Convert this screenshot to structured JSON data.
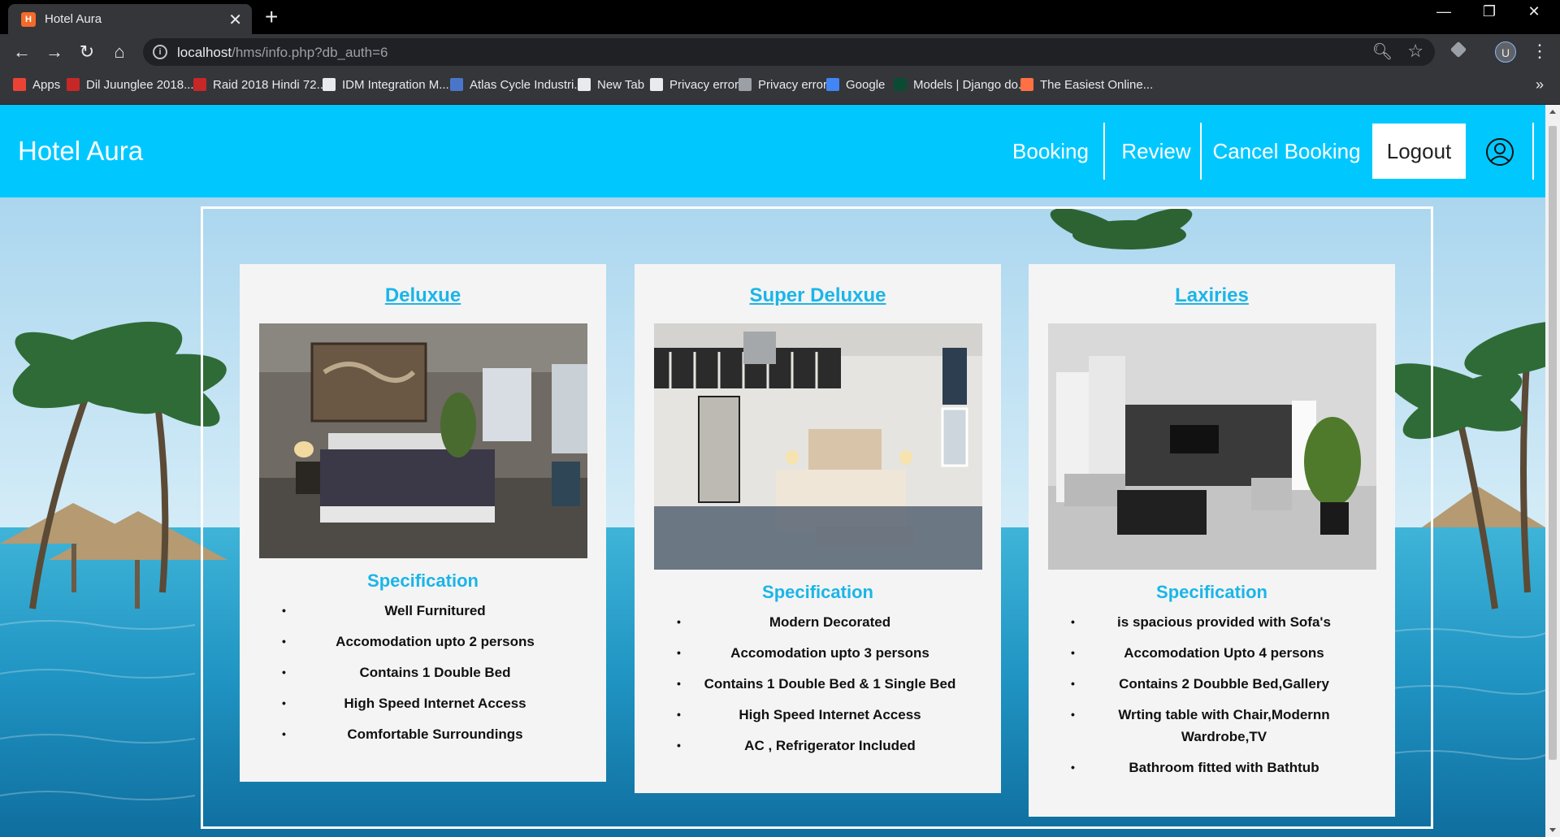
{
  "browser": {
    "tab_title": "Hotel Aura",
    "tab_favicon": "H",
    "url_host": "localhost",
    "url_path": "/hms/info.php?db_auth=6",
    "profile_initial": "U",
    "bookmarks": [
      {
        "label": "Apps",
        "color": "#ea4335"
      },
      {
        "label": "Dil Juunglee 2018...",
        "color": "#c62828"
      },
      {
        "label": "Raid 2018 Hindi 72...",
        "color": "#c62828"
      },
      {
        "label": "IDM Integration M...",
        "color": "#e8eaed"
      },
      {
        "label": "Atlas Cycle Industri...",
        "color": "#4a76c9"
      },
      {
        "label": "New Tab",
        "color": "#e8eaed"
      },
      {
        "label": "Privacy error",
        "color": "#e8eaed"
      },
      {
        "label": "Privacy error",
        "color": "#9aa0a6"
      },
      {
        "label": "Google",
        "color": "#4285f4"
      },
      {
        "label": "Models | Django do...",
        "color": "#0c4b33"
      },
      {
        "label": "The Easiest Online...",
        "color": "#ff7043"
      }
    ]
  },
  "header": {
    "brand": "Hotel Aura",
    "nav": [
      "Booking",
      "Review",
      "Cancel Booking"
    ],
    "logout": "Logout",
    "color": "#00c8ff"
  },
  "cards": [
    {
      "title": "Deluxue",
      "spec_heading": "Specification",
      "items": [
        "Well Furnitured",
        "Accomodation upto 2 persons",
        "Contains 1 Double Bed",
        "High Speed Internet Access",
        "Comfortable Surroundings"
      ]
    },
    {
      "title": "Super Deluxue",
      "spec_heading": "Specification",
      "items": [
        "Modern Decorated",
        "Accomodation upto 3 persons",
        "Contains 1 Double Bed & 1 Single Bed",
        "High Speed Internet Access",
        "AC , Refrigerator Included"
      ]
    },
    {
      "title": "Laxiries",
      "spec_heading": "Specification",
      "items": [
        "is spacious provided with Sofa's",
        "Accomodation Upto 4 persons",
        "Contains 2 Doubble Bed,Gallery",
        "Wrting table with Chair,Modernn Wardrobe,TV",
        "Bathroom fitted with Bathtub"
      ]
    }
  ],
  "accent_color": "#1bb5e8"
}
